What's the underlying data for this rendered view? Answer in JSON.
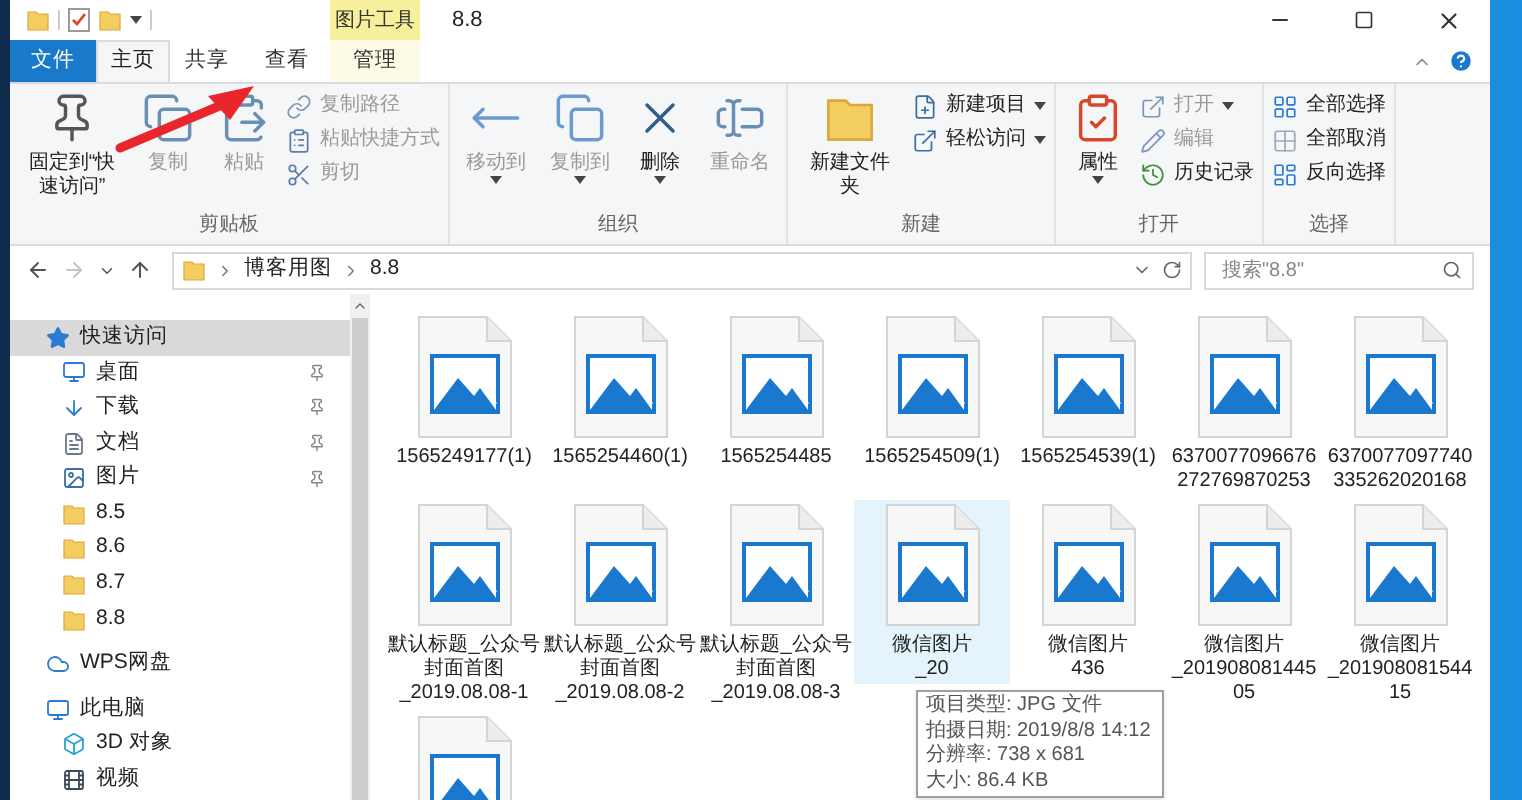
{
  "window": {
    "title": "8.8",
    "context_tab_header": "图片工具"
  },
  "tabs": [
    {
      "label": "文件",
      "kind": "file",
      "selected": false
    },
    {
      "label": "主页",
      "kind": "tab",
      "selected": true
    },
    {
      "label": "共享",
      "kind": "tab",
      "selected": false
    },
    {
      "label": "查看",
      "kind": "tab",
      "selected": false
    },
    {
      "label": "管理",
      "kind": "context",
      "selected": false
    }
  ],
  "ribbon_groups": [
    {
      "label": "剪贴板",
      "items": [
        {
          "label": "固定到“快速访问”",
          "kind": "large",
          "disabled": false,
          "dropdown": false
        },
        {
          "label": "复制",
          "kind": "large",
          "disabled": true,
          "dropdown": false
        },
        {
          "label": "粘贴",
          "kind": "large",
          "disabled": true,
          "dropdown": false
        },
        {
          "label": "复制路径",
          "kind": "small",
          "disabled": true,
          "dropdown": false
        },
        {
          "label": "粘贴快捷方式",
          "kind": "small",
          "disabled": true,
          "dropdown": false
        },
        {
          "label": "剪切",
          "kind": "small",
          "disabled": true,
          "dropdown": false
        }
      ]
    },
    {
      "label": "组织",
      "items": [
        {
          "label": "移动到",
          "kind": "large",
          "disabled": true,
          "dropdown": true
        },
        {
          "label": "复制到",
          "kind": "large",
          "disabled": true,
          "dropdown": true
        },
        {
          "label": "删除",
          "kind": "large",
          "disabled": false,
          "dropdown": true
        },
        {
          "label": "重命名",
          "kind": "large",
          "disabled": true,
          "dropdown": false
        }
      ]
    },
    {
      "label": "新建",
      "items": [
        {
          "label": "新建文件夹",
          "kind": "large",
          "disabled": false,
          "dropdown": false
        },
        {
          "label": "新建项目",
          "kind": "small",
          "disabled": false,
          "dropdown": true
        },
        {
          "label": "轻松访问",
          "kind": "small",
          "disabled": false,
          "dropdown": true
        }
      ]
    },
    {
      "label": "打开",
      "items": [
        {
          "label": "属性",
          "kind": "large",
          "disabled": false,
          "dropdown": true
        },
        {
          "label": "打开",
          "kind": "small",
          "disabled": true,
          "dropdown": true
        },
        {
          "label": "编辑",
          "kind": "small",
          "disabled": true,
          "dropdown": false
        },
        {
          "label": "历史记录",
          "kind": "small",
          "disabled": false,
          "dropdown": false
        }
      ]
    },
    {
      "label": "选择",
      "items": [
        {
          "label": "全部选择",
          "kind": "small",
          "disabled": false,
          "dropdown": false
        },
        {
          "label": "全部取消",
          "kind": "small",
          "disabled": false,
          "dropdown": false
        },
        {
          "label": "反向选择",
          "kind": "small",
          "disabled": false,
          "dropdown": false
        }
      ]
    }
  ],
  "nav_buttons": [
    {
      "kind": "back",
      "disabled": false
    },
    {
      "kind": "forward",
      "disabled": true
    },
    {
      "kind": "recent",
      "disabled": false
    },
    {
      "kind": "up",
      "disabled": false
    }
  ],
  "breadcrumbs": [
    "博客用图",
    "8.8"
  ],
  "search": {
    "placeholder": "搜索\"8.8\""
  },
  "sidebar": {
    "items": [
      {
        "label": "快速访问",
        "kind": "star",
        "selected": true,
        "children": [
          {
            "label": "桌面",
            "kind": "desktop",
            "selected": false,
            "pinned": true
          },
          {
            "label": "下载",
            "kind": "download",
            "selected": false,
            "pinned": true
          },
          {
            "label": "文档",
            "kind": "document",
            "selected": false,
            "pinned": true
          },
          {
            "label": "图片",
            "kind": "picture",
            "selected": false,
            "pinned": true
          },
          {
            "label": "8.5",
            "kind": "folder",
            "selected": false,
            "pinned": false
          },
          {
            "label": "8.6",
            "kind": "folder",
            "selected": false,
            "pinned": false
          },
          {
            "label": "8.7",
            "kind": "folder",
            "selected": false,
            "pinned": false
          },
          {
            "label": "8.8",
            "kind": "folder",
            "selected": false,
            "pinned": false
          }
        ]
      },
      {
        "label": "WPS网盘",
        "kind": "cloud",
        "selected": false
      },
      {
        "label": "此电脑",
        "kind": "computer",
        "selected": false,
        "children": [
          {
            "label": "3D 对象",
            "kind": "cube",
            "selected": false
          },
          {
            "label": "视频",
            "kind": "video",
            "selected": false
          }
        ]
      }
    ]
  },
  "files": [
    {
      "name_lines": [
        "1565249177(1)"
      ],
      "selected": false
    },
    {
      "name_lines": [
        "1565254460(1)"
      ],
      "selected": false
    },
    {
      "name_lines": [
        "1565254485"
      ],
      "selected": false
    },
    {
      "name_lines": [
        "1565254509(1)"
      ],
      "selected": false
    },
    {
      "name_lines": [
        "1565254539(1)"
      ],
      "selected": false
    },
    {
      "name_lines": [
        "6370077096676",
        "272769870253"
      ],
      "selected": false
    },
    {
      "name_lines": [
        "6370077097740",
        "335262020168"
      ],
      "selected": false
    },
    {
      "name_lines": [
        "默认标题_公众号",
        "封面首图",
        "_2019.08.08-1"
      ],
      "selected": false
    },
    {
      "name_lines": [
        "默认标题_公众号",
        "封面首图",
        "_2019.08.08-2"
      ],
      "selected": false
    },
    {
      "name_lines": [
        "默认标题_公众号",
        "封面首图",
        "_2019.08.08-3"
      ],
      "selected": false
    },
    {
      "name_lines": [
        "微信图片",
        "_20"
      ],
      "selected": true
    },
    {
      "name_lines": [
        "微信图片",
        "436"
      ],
      "selected": false
    },
    {
      "name_lines": [
        "微信图片",
        "_201908081445",
        "05"
      ],
      "selected": false
    },
    {
      "name_lines": [
        "微信图片",
        "_201908081544",
        "15"
      ],
      "selected": false
    },
    {
      "selected": false
    }
  ],
  "tooltip": {
    "lines": [
      "项目类型: JPG 文件",
      "拍摄日期: 2019/8/8 14:12",
      "分辨率: 738 x 681",
      "大小: 86.4 KB"
    ]
  }
}
